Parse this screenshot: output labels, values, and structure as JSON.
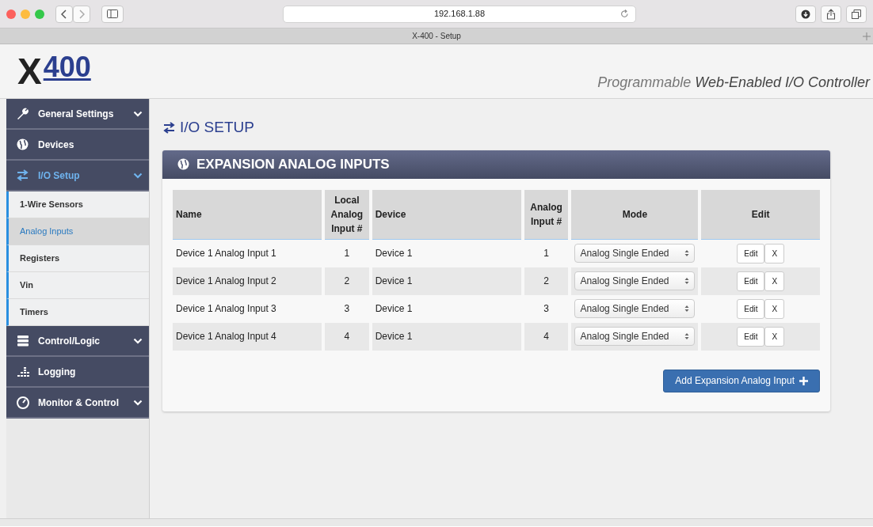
{
  "browser": {
    "address": "192.168.1.88",
    "tab_title": "X-400 - Setup"
  },
  "header": {
    "logo": {
      "letter": "X",
      "number": "400"
    },
    "tagline": "Programmable **Web-Enabled I/O Controller**"
  },
  "sidebar": {
    "items": [
      {
        "label": "General Settings",
        "expandable": true,
        "selected": false
      },
      {
        "label": "Devices",
        "expandable": false,
        "selected": false
      },
      {
        "label": "I/O Setup",
        "expandable": true,
        "selected": true,
        "children": [
          {
            "label": "1-Wire Sensors",
            "selected": false
          },
          {
            "label": "Analog Inputs",
            "selected": true
          },
          {
            "label": "Registers",
            "selected": false
          },
          {
            "label": "Vin",
            "selected": false
          },
          {
            "label": "Timers",
            "selected": false
          }
        ]
      },
      {
        "label": "Control/Logic",
        "expandable": true,
        "selected": false
      },
      {
        "label": "Logging",
        "expandable": false,
        "selected": false
      },
      {
        "label": "Monitor & Control",
        "expandable": true,
        "selected": false
      }
    ]
  },
  "page_title": "I/O SETUP",
  "panel": {
    "title": "EXPANSION ANALOG INPUTS",
    "table": {
      "columns": [
        "Name",
        "Local Analog Input #",
        "Device",
        "Analog Input #",
        "Mode",
        "Edit"
      ],
      "rows": [
        {
          "name": "Device 1 Analog Input 1",
          "local_input": "1",
          "device": "Device 1",
          "analog_input": "1",
          "mode": "Analog Single Ended",
          "edit": "Edit",
          "delete": "X"
        },
        {
          "name": "Device 1 Analog Input 2",
          "local_input": "2",
          "device": "Device 1",
          "analog_input": "2",
          "mode": "Analog Single Ended",
          "edit": "Edit",
          "delete": "X"
        },
        {
          "name": "Device 1 Analog Input 3",
          "local_input": "3",
          "device": "Device 1",
          "analog_input": "3",
          "mode": "Analog Single Ended",
          "edit": "Edit",
          "delete": "X"
        },
        {
          "name": "Device 1 Analog Input 4",
          "local_input": "4",
          "device": "Device 1",
          "analog_input": "4",
          "mode": "Analog Single Ended",
          "edit": "Edit",
          "delete": "X"
        }
      ]
    },
    "add_button": "Add Expansion Analog Input"
  }
}
